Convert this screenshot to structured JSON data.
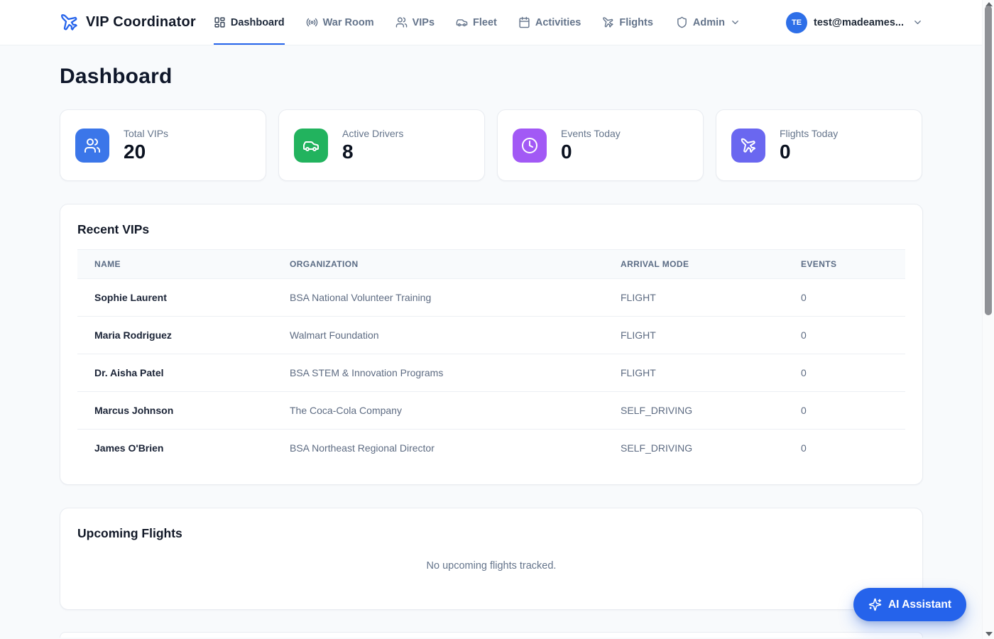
{
  "header": {
    "brand": "VIP Coordinator",
    "brand_icon": "plane-icon",
    "nav": [
      {
        "label": "Dashboard",
        "icon": "dashboard-icon",
        "active": true
      },
      {
        "label": "War Room",
        "icon": "radio-icon",
        "active": false
      },
      {
        "label": "VIPs",
        "icon": "users-icon",
        "active": false
      },
      {
        "label": "Fleet",
        "icon": "car-icon",
        "active": false
      },
      {
        "label": "Activities",
        "icon": "calendar-icon",
        "active": false
      },
      {
        "label": "Flights",
        "icon": "plane-icon",
        "active": false
      }
    ],
    "admin": {
      "label": "Admin",
      "icon": "shield-icon",
      "chevron_icon": "chevron-down-icon"
    },
    "user": {
      "initials": "TE",
      "email": "test@madeames...",
      "chevron_icon": "chevron-down-icon",
      "avatar_color": "#2e6fe8"
    }
  },
  "page": {
    "title": "Dashboard"
  },
  "stats": [
    {
      "label": "Total VIPs",
      "value": "20",
      "icon": "users-icon",
      "color": "#3b76e9"
    },
    {
      "label": "Active Drivers",
      "value": "8",
      "icon": "car-icon",
      "color": "#22b35e"
    },
    {
      "label": "Events Today",
      "value": "0",
      "icon": "clock-icon",
      "color": "#a259f5"
    },
    {
      "label": "Flights Today",
      "value": "0",
      "icon": "plane-icon",
      "color": "#6a67f0"
    }
  ],
  "recent_vips": {
    "title": "Recent VIPs",
    "columns": [
      "NAME",
      "ORGANIZATION",
      "ARRIVAL MODE",
      "EVENTS"
    ],
    "rows": [
      {
        "name": "Sophie Laurent",
        "organization": "BSA National Volunteer Training",
        "arrival_mode": "FLIGHT",
        "events": "0"
      },
      {
        "name": "Maria Rodriguez",
        "organization": "Walmart Foundation",
        "arrival_mode": "FLIGHT",
        "events": "0"
      },
      {
        "name": "Dr. Aisha Patel",
        "organization": "BSA STEM & Innovation Programs",
        "arrival_mode": "FLIGHT",
        "events": "0"
      },
      {
        "name": "Marcus Johnson",
        "organization": "The Coca-Cola Company",
        "arrival_mode": "SELF_DRIVING",
        "events": "0"
      },
      {
        "name": "James O'Brien",
        "organization": "BSA Northeast Regional Director",
        "arrival_mode": "SELF_DRIVING",
        "events": "0"
      }
    ]
  },
  "upcoming_flights": {
    "title": "Upcoming Flights",
    "empty_text": "No upcoming flights tracked."
  },
  "ai_assistant": {
    "label": "AI Assistant",
    "icon": "sparkles-icon",
    "color": "#2563eb"
  },
  "colors": {
    "accent": "#2563eb",
    "page_background": "#f8fafc",
    "nav_inactive": "#64748b",
    "nav_active": "#1e293b"
  }
}
